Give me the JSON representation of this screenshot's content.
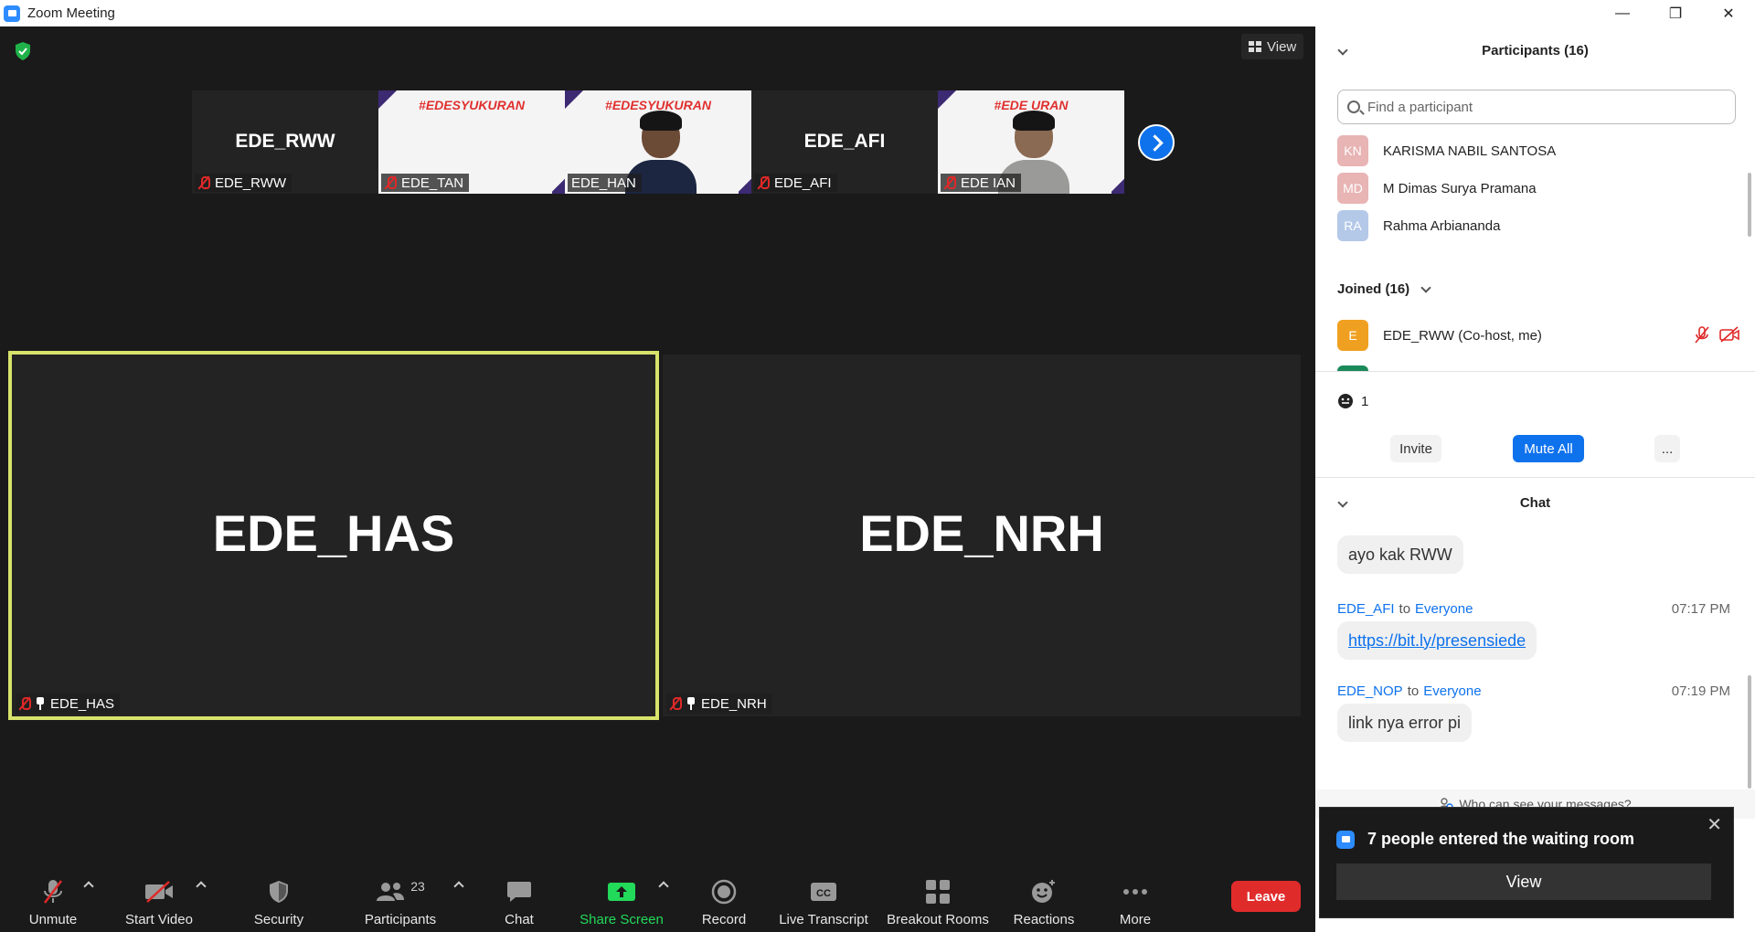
{
  "window": {
    "title": "Zoom Meeting",
    "minimize": "—",
    "restore": "❐",
    "close": "✕"
  },
  "meeting": {
    "view_label": "View",
    "thumbnails": [
      {
        "big": "EDE_RWW",
        "label": "EDE_RWW",
        "kind": "name"
      },
      {
        "banner": "#EDESYUKURAN",
        "label": "EDE_TAN",
        "kind": "banner"
      },
      {
        "banner": "#EDESYUKURAN",
        "label": "EDE_HAN",
        "kind": "person"
      },
      {
        "big": "EDE_AFI",
        "label": "EDE_AFI",
        "kind": "name"
      },
      {
        "banner": "#EDE    URAN",
        "label": "EDE IAN",
        "kind": "person"
      }
    ],
    "tiles": [
      {
        "name": "EDE_HAS",
        "label": "EDE_HAS",
        "active": true
      },
      {
        "name": "EDE_NRH",
        "label": "EDE_NRH",
        "active": false
      }
    ]
  },
  "toolbar": {
    "unmute": "Unmute",
    "start_video": "Start Video",
    "security": "Security",
    "participants": "Participants",
    "participants_count": "23",
    "chat": "Chat",
    "share_screen": "Share Screen",
    "record": "Record",
    "live_transcript": "Live Transcript",
    "breakout_rooms": "Breakout Rooms",
    "reactions": "Reactions",
    "more": "More",
    "leave": "Leave"
  },
  "participants_panel": {
    "title": "Participants (16)",
    "search_placeholder": "Find a participant",
    "waiting": [
      {
        "initials": "KN",
        "name": "KARISMA NABIL SANTOSA",
        "color": "#e8b4b4"
      },
      {
        "initials": "MD",
        "name": "M Dimas Surya Pramana",
        "color": "#e8b4b4"
      },
      {
        "initials": "RA",
        "name": "Rahma Arbiananda",
        "color": "#b4c8e8"
      }
    ],
    "joined_label": "Joined (16)",
    "joined": [
      {
        "initials": "E",
        "name": "EDE_RWW (Co-host, me)",
        "color": "#f0a020"
      }
    ],
    "raised_count": "1",
    "invite": "Invite",
    "mute_all": "Mute All",
    "more": "..."
  },
  "chat": {
    "title": "Chat",
    "messages": [
      {
        "from": "",
        "to": "",
        "time": "",
        "text": "ayo kak RWW"
      },
      {
        "from": "EDE_AFI",
        "to_word": "to",
        "to": "Everyone",
        "time": "07:17 PM",
        "text": "https://bit.ly/presensiede"
      },
      {
        "from": "EDE_NOP",
        "to_word": "to",
        "to": "Everyone",
        "time": "07:19 PM",
        "text": "link nya error pi"
      }
    ],
    "who_can_see": "Who can see your messages?"
  },
  "toast": {
    "text": "7 people entered the waiting room",
    "button": "View",
    "close": "✕"
  }
}
